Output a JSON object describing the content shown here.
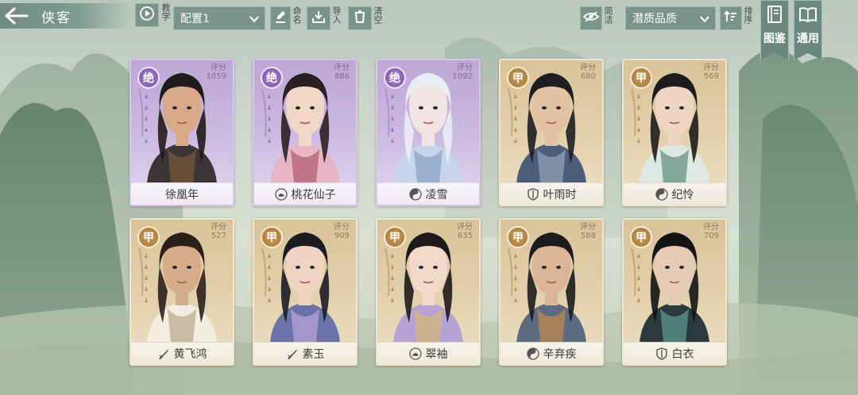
{
  "header": {
    "title": "侠客",
    "tutorial_label": "教学",
    "config_select": "配置1",
    "rename_label": "命名",
    "import_label": "导入",
    "clear_label": "清空",
    "simple_label": "简洁",
    "quality_select": "潜质品质",
    "sort_label": "排序",
    "codex_label": "图鉴",
    "common_label": "通用"
  },
  "score_label": "评分",
  "colors": {
    "purple_card": "#c6b3de",
    "gold_card": "#e0cca5",
    "topbar": "#7b948b"
  },
  "cards": [
    {
      "name": "徐凰年",
      "grade": "绝",
      "score": "1059",
      "rarity": "purple",
      "school_icon": ""
    },
    {
      "name": "桃花仙子",
      "grade": "绝",
      "score": "886",
      "rarity": "purple",
      "school_icon": "lotus-icon"
    },
    {
      "name": "凌雪",
      "grade": "绝",
      "score": "1092",
      "rarity": "purple",
      "school_icon": "yin-yang-icon"
    },
    {
      "name": "叶雨时",
      "grade": "甲",
      "score": "680",
      "rarity": "gold",
      "school_icon": "shield-icon"
    },
    {
      "name": "纪怜",
      "grade": "甲",
      "score": "569",
      "rarity": "gold",
      "school_icon": "yin-yang-icon"
    },
    {
      "name": "黄飞鸿",
      "grade": "甲",
      "score": "527",
      "rarity": "gold",
      "school_icon": "sword-icon"
    },
    {
      "name": "素玉",
      "grade": "甲",
      "score": "909",
      "rarity": "gold",
      "school_icon": "sword-icon"
    },
    {
      "name": "翠袖",
      "grade": "甲",
      "score": "635",
      "rarity": "gold",
      "school_icon": "lotus-icon"
    },
    {
      "name": "辛弃疾",
      "grade": "甲",
      "score": "588",
      "rarity": "gold",
      "school_icon": "yin-yang-icon"
    },
    {
      "name": "白衣",
      "grade": "甲",
      "score": "709",
      "rarity": "gold",
      "school_icon": "shield-icon"
    }
  ]
}
